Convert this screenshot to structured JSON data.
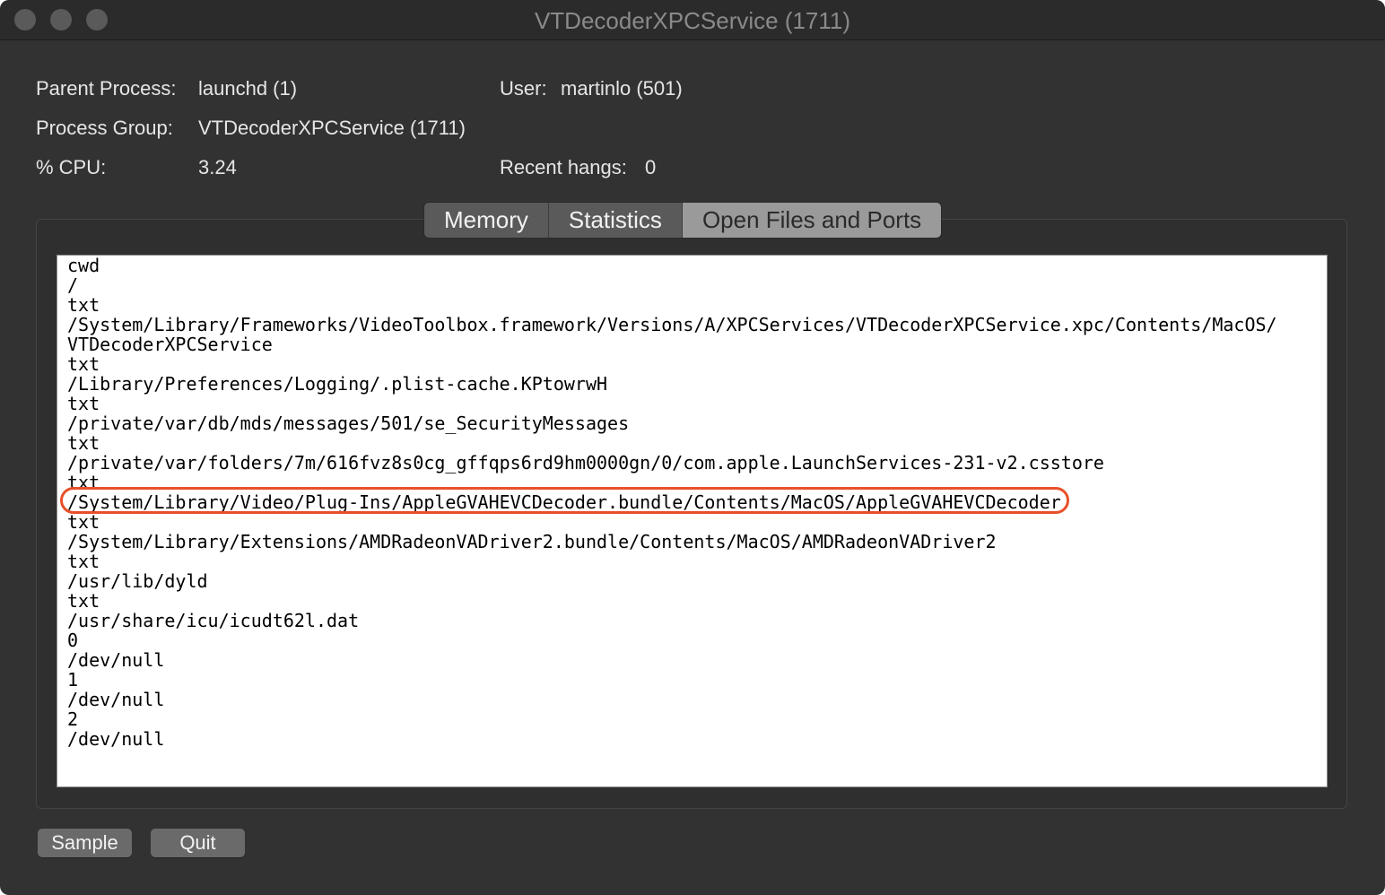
{
  "window": {
    "title": "VTDecoderXPCService (1711)"
  },
  "info": {
    "parent_process_label": "Parent Process:",
    "parent_process_value": "launchd (1)",
    "process_group_label": "Process Group:",
    "process_group_value": "VTDecoderXPCService (1711)",
    "cpu_label": "% CPU:",
    "cpu_value": "3.24",
    "user_label": "User:",
    "user_value": "martinlo (501)",
    "recent_hangs_label": "Recent hangs:",
    "recent_hangs_value": "0"
  },
  "tabs": [
    {
      "label": "Memory",
      "active": false
    },
    {
      "label": "Statistics",
      "active": false
    },
    {
      "label": "Open Files and Ports",
      "active": true
    }
  ],
  "open_files": [
    "cwd",
    "/",
    "txt",
    "/System/Library/Frameworks/VideoToolbox.framework/Versions/A/XPCServices/VTDecoderXPCService.xpc/Contents/MacOS/",
    "VTDecoderXPCService",
    "txt",
    "/Library/Preferences/Logging/.plist-cache.KPtowrwH",
    "txt",
    "/private/var/db/mds/messages/501/se_SecurityMessages",
    "txt",
    "/private/var/folders/7m/616fvz8s0cg_gffqps6rd9hm0000gn/0/com.apple.LaunchServices-231-v2.csstore",
    "txt",
    "/System/Library/Video/Plug-Ins/AppleGVAHEVCDecoder.bundle/Contents/MacOS/AppleGVAHEVCDecoder",
    "txt",
    "/System/Library/Extensions/AMDRadeonVADriver2.bundle/Contents/MacOS/AMDRadeonVADriver2",
    "txt",
    "/usr/lib/dyld",
    "txt",
    "/usr/share/icu/icudt62l.dat",
    "0",
    "/dev/null",
    "1",
    "/dev/null",
    "2",
    "/dev/null"
  ],
  "highlight": {
    "color": "#e8502a"
  },
  "buttons": {
    "sample_label": "Sample",
    "quit_label": "Quit"
  }
}
